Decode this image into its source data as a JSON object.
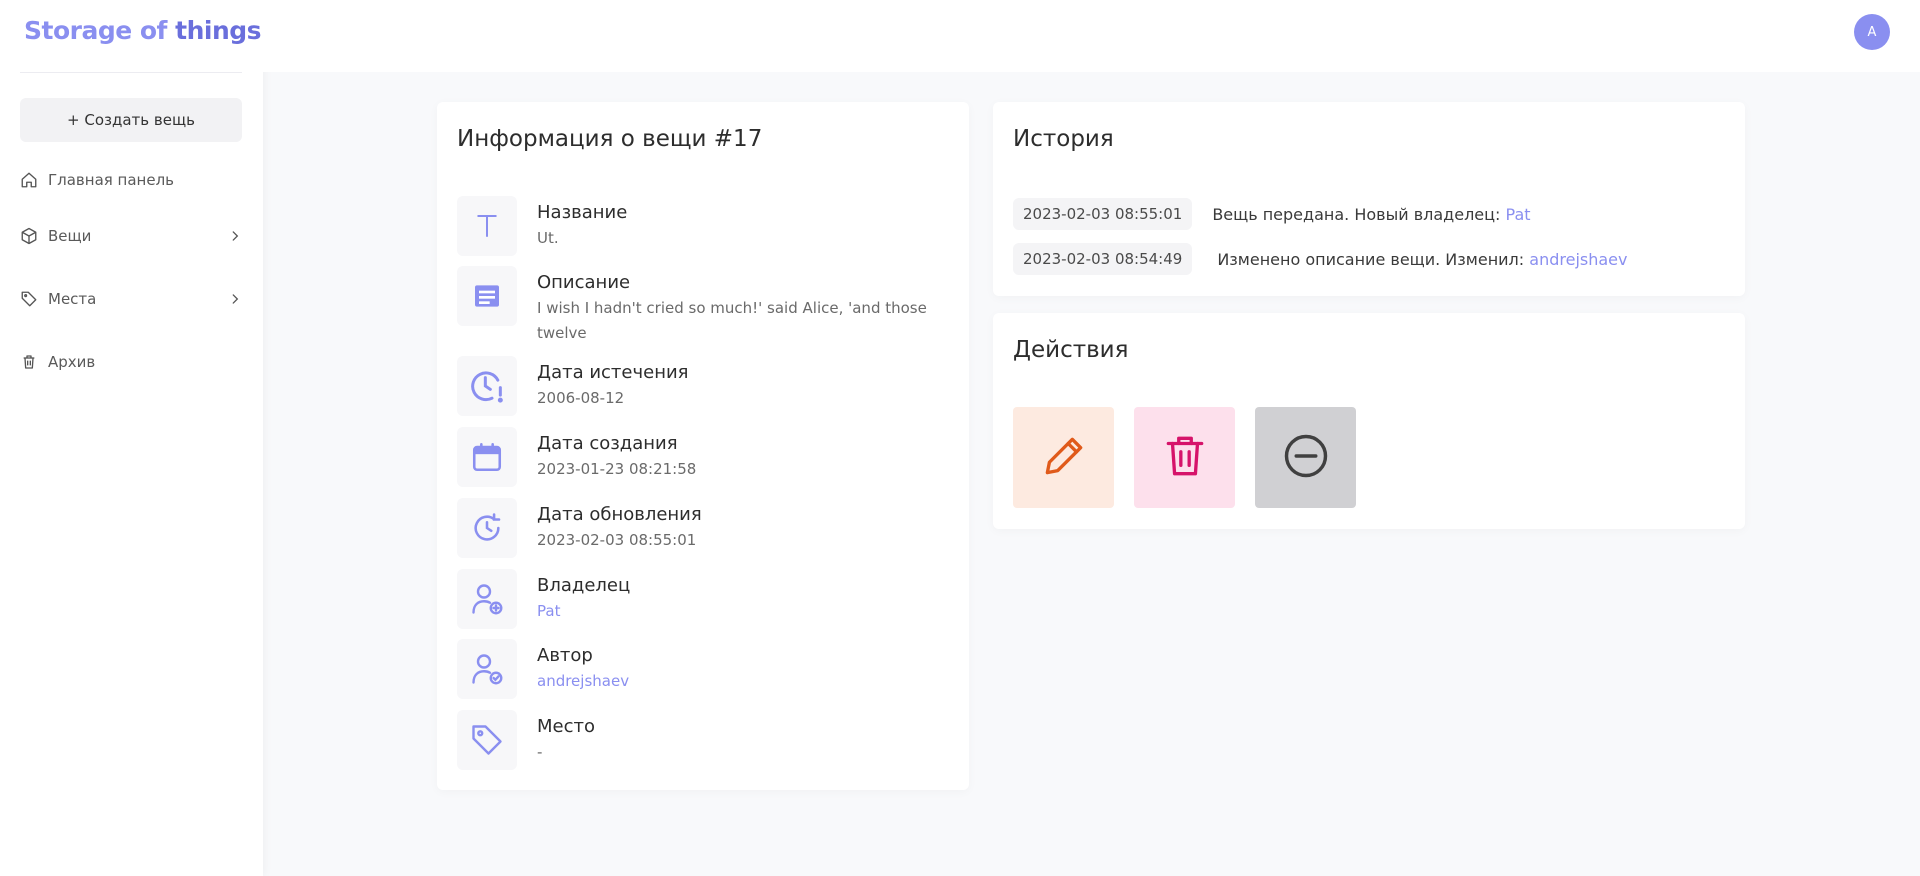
{
  "app": {
    "logo_part1": "Storage of",
    "logo_part2": "things",
    "avatar_initial": "A"
  },
  "sidebar": {
    "create_button": "+ Создать вещь",
    "items": [
      {
        "label": "Главная панель",
        "icon": "home-icon",
        "has_submenu": false
      },
      {
        "label": "Вещи",
        "icon": "box-icon",
        "has_submenu": true
      },
      {
        "label": "Места",
        "icon": "tag-icon",
        "has_submenu": true
      },
      {
        "label": "Архив",
        "icon": "trash-icon",
        "has_submenu": false
      }
    ]
  },
  "info": {
    "title": "Информация о вещи #17",
    "fields": [
      {
        "label": "Название",
        "value": "Ut.",
        "icon": "text-icon"
      },
      {
        "label": "Описание",
        "value": "I wish I hadn't cried so much!' said Alice, 'and those twelve",
        "icon": "description-icon"
      },
      {
        "label": "Дата истечения",
        "value": "2006-08-12",
        "icon": "clock-alert-icon"
      },
      {
        "label": "Дата создания",
        "value": "2023-01-23 08:21:58",
        "icon": "calendar-icon"
      },
      {
        "label": "Дата обновления",
        "value": "2023-02-03 08:55:01",
        "icon": "clock-refresh-icon"
      },
      {
        "label": "Владелец",
        "value": "Pat",
        "icon": "user-plus-icon"
      },
      {
        "label": "Автор",
        "value": "andrejshaev",
        "icon": "user-check-icon"
      },
      {
        "label": "Место",
        "value": "-",
        "icon": "tag-icon"
      }
    ]
  },
  "history": {
    "title": "История",
    "entries": [
      {
        "date": "2023-02-03 08:55:01",
        "text": "Вещь передана. Новый владелец:",
        "user": "Pat"
      },
      {
        "date": "2023-02-03 08:54:49",
        "text": "Изменено описание вещи. Изменил:",
        "user": "andrejshaev"
      }
    ]
  },
  "actions": {
    "title": "Действия",
    "buttons": [
      {
        "name": "edit",
        "icon": "pencil-icon",
        "color": "#e05a1a",
        "bg": "#fdeae0"
      },
      {
        "name": "delete",
        "icon": "trash-icon",
        "color": "#d6136a",
        "bg": "#fde0ec"
      },
      {
        "name": "archive",
        "icon": "minus-circle-icon",
        "color": "#404040",
        "bg": "#d0d0d3"
      }
    ]
  },
  "colors": {
    "accent": "#8a8ff0",
    "accent_dark": "#6a6fdc"
  }
}
